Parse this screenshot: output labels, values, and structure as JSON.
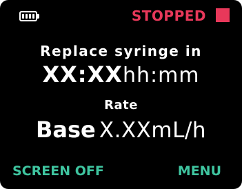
{
  "status_bar": {
    "battery_icon": "battery-full-icon",
    "battery_level": 1.0,
    "status_text": "STOPPED",
    "status_color": "#e8385a",
    "stop_icon": "stop-square-icon"
  },
  "main": {
    "title": "Replace syringe in",
    "time_value": "XX:XX",
    "time_unit": "hh:mm",
    "rate_label": "Rate",
    "rate_mode": "Base",
    "rate_value": "X.XXmL/h"
  },
  "softkeys": {
    "left_label": "SCREEN OFF",
    "right_label": "MENU",
    "color": "#3fc5a0"
  },
  "colors": {
    "background": "#000000",
    "text": "#ffffff"
  }
}
